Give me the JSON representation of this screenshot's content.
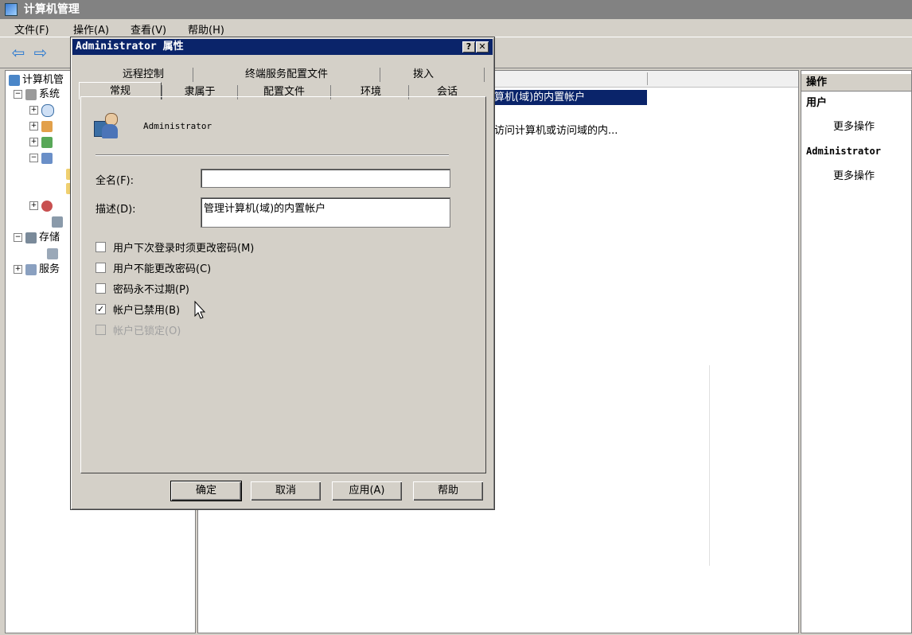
{
  "app": {
    "title": "计算机管理"
  },
  "menu": [
    "文件(F)",
    "操作(A)",
    "查看(V)",
    "帮助(H)"
  ],
  "tree": {
    "root": "计算机管",
    "system": "系统",
    "storage": "存储",
    "services": "服务"
  },
  "list": {
    "selected_row": "算机(域)的内置帐户",
    "row2": "访问计算机或访问域的内..."
  },
  "actions": {
    "header": "操作",
    "section1": "用户",
    "more1": "更多操作",
    "section2": "Administrator",
    "more2": "更多操作"
  },
  "dialog": {
    "title": "Administrator 属性",
    "help_btn": "?",
    "close_btn": "✕",
    "tabs_back": [
      "远程控制",
      "终端服务配置文件",
      "拨入"
    ],
    "tabs_front": [
      "常规",
      "隶属于",
      "配置文件",
      "环境",
      "会话"
    ],
    "username": "Administrator",
    "fullname_label": "全名(F):",
    "fullname_value": "",
    "desc_label": "描述(D):",
    "desc_value": "管理计算机(域)的内置帐户",
    "checkboxes": [
      {
        "label": "用户下次登录时须更改密码(M)",
        "checked": false,
        "disabled": false
      },
      {
        "label": "用户不能更改密码(C)",
        "checked": false,
        "disabled": false
      },
      {
        "label": "密码永不过期(P)",
        "checked": false,
        "disabled": false
      },
      {
        "label": "帐户已禁用(B)",
        "checked": true,
        "disabled": false
      },
      {
        "label": "帐户已锁定(O)",
        "checked": false,
        "disabled": true
      }
    ],
    "buttons": {
      "ok": "确定",
      "cancel": "取消",
      "apply": "应用(A)",
      "help": "帮助"
    }
  }
}
